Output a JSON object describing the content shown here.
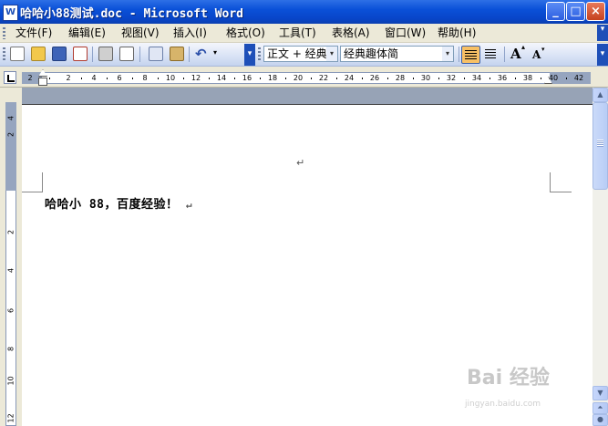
{
  "window": {
    "title": "哈哈小88测试.doc - Microsoft Word",
    "icon_glyph": "W",
    "minimize_glyph": "_",
    "maximize_glyph": "□",
    "close_glyph": "×"
  },
  "menus": [
    "文件(F)",
    "编辑(E)",
    "视图(V)",
    "插入(I)",
    "格式(O)",
    "工具(T)",
    "表格(A)",
    "窗口(W)",
    "帮助(H)"
  ],
  "toolbar": {
    "style_value": "正文 + 经典",
    "font_value": "经典趣体简",
    "font_grow_glyph": "A",
    "font_shrink_glyph": "A"
  },
  "ruler": {
    "ticks": [
      "2",
      "2",
      "4",
      "6",
      "8",
      "10",
      "12",
      "14",
      "16",
      "18",
      "20",
      "22",
      "24",
      "26",
      "28",
      "30",
      "32",
      "34",
      "36",
      "38",
      "40",
      "42"
    ]
  },
  "vertical_ruler": {
    "ticks": [
      "4",
      "2",
      "2",
      "4",
      "6",
      "8",
      "10",
      "12"
    ]
  },
  "document": {
    "paragraph_mark": "↵",
    "body_text": "哈哈小 88，百度经验！"
  },
  "watermark": {
    "brand": "Bai 经验",
    "url": "jingyan.baidu.com"
  }
}
